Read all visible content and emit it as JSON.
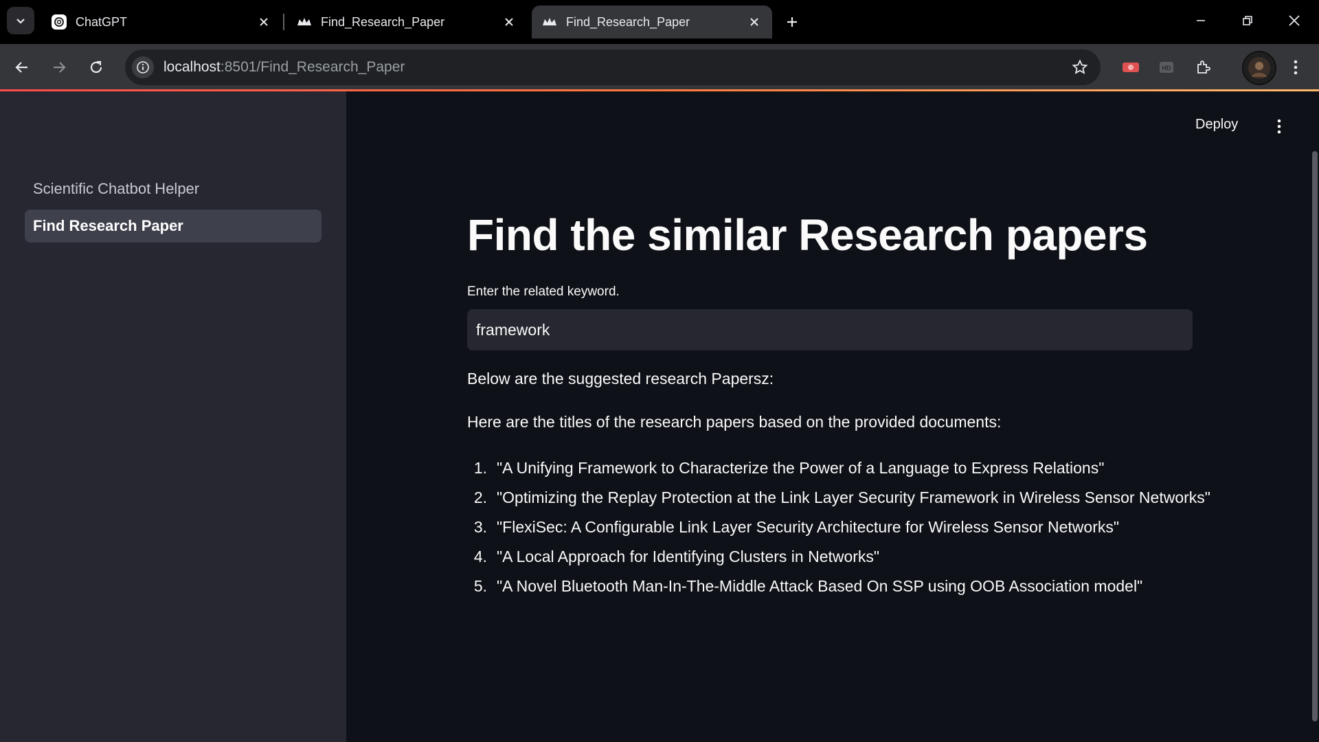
{
  "browser": {
    "tabs": [
      {
        "title": "ChatGPT",
        "favicon": "chatgpt-icon",
        "active": false
      },
      {
        "title": "Find_Research_Paper",
        "favicon": "streamlit-crown-icon",
        "active": false
      },
      {
        "title": "Find_Research_Paper",
        "favicon": "streamlit-crown-icon",
        "active": true
      }
    ],
    "url_host": "localhost",
    "url_rest": ":8501/Find_Research_Paper",
    "accent_colors": [
      "#ff4b4b",
      "#ffb86b"
    ]
  },
  "header": {
    "deploy_label": "Deploy"
  },
  "sidebar": {
    "items": [
      {
        "label": "Scientific Chatbot Helper",
        "active": false
      },
      {
        "label": "Find Research Paper",
        "active": true
      }
    ]
  },
  "main": {
    "title": "Find the similar Research papers",
    "input_label": "Enter the related keyword.",
    "input_value": "framework",
    "intro": "Below are the suggested research Papersz:",
    "subintro": "Here are the titles of the research papers based on the provided documents:",
    "results": [
      {
        "num": "1.",
        "title": "\"A Unifying Framework to Characterize the Power of a Language to Express Relations\""
      },
      {
        "num": "2.",
        "title": "\"Optimizing the Replay Protection at the Link Layer Security Framework in Wireless Sensor Networks\""
      },
      {
        "num": "3.",
        "title": "\"FlexiSec: A Configurable Link Layer Security Architecture for Wireless Sensor Networks\""
      },
      {
        "num": "4.",
        "title": "\"A Local Approach for Identifying Clusters in Networks\""
      },
      {
        "num": "5.",
        "title": "\"A Novel Bluetooth Man-In-The-Middle Attack Based On SSP using OOB Association model\""
      }
    ]
  }
}
